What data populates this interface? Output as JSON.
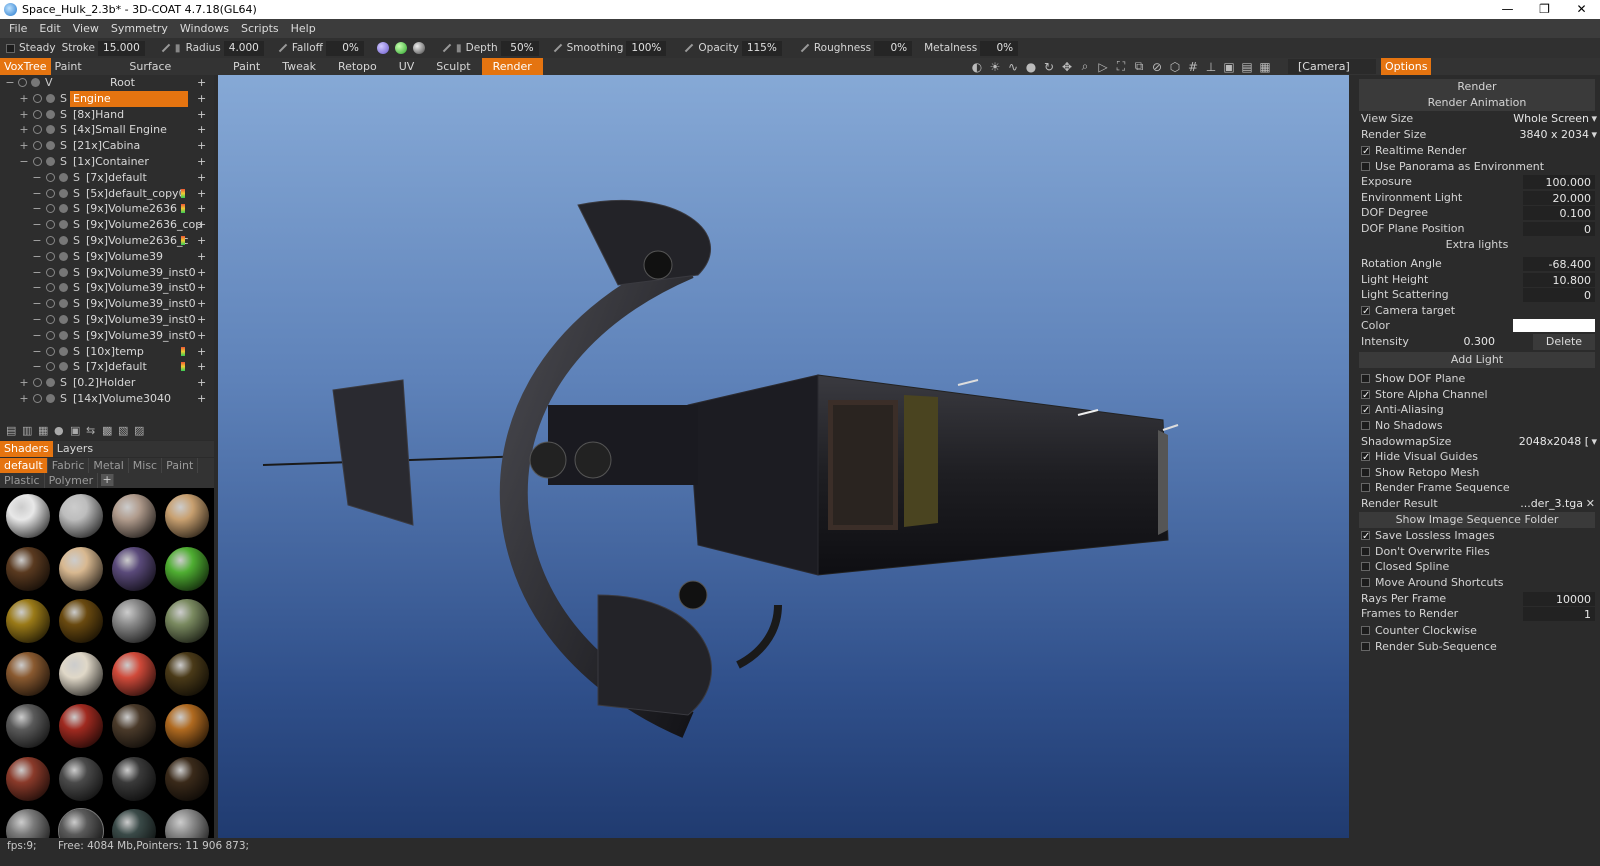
{
  "window": {
    "title": "Space_Hulk_2.3b* - 3D-COAT 4.7.18(GL64)",
    "controls": [
      "—",
      "❐",
      "✕"
    ]
  },
  "menu": [
    "File",
    "Edit",
    "View",
    "Symmetry",
    "Windows",
    "Scripts",
    "Help"
  ],
  "toolbar": {
    "steady_label": "Steady",
    "stroke_label": "Stroke",
    "stroke_value": "15.000",
    "radius_label": "Radius",
    "radius_value": "4.000",
    "falloff_label": "Falloff",
    "falloff_value": "0%",
    "depth_label": "Depth",
    "depth_value": "50%",
    "smoothing_label": "Smoothing",
    "smoothing_value": "100%",
    "opacity_label": "Opacity",
    "opacity_value": "115%",
    "roughness_label": "Roughness",
    "roughness_value": "0%",
    "metalness_label": "Metalness",
    "metalness_value": "0%"
  },
  "left_tabs": [
    "VoxTree",
    "Paint Objects",
    "Surface Materials"
  ],
  "room_tabs": [
    "Paint",
    "Tweak",
    "Retopo",
    "UV",
    "Sculpt",
    "Render"
  ],
  "active_room": "Render",
  "camera_label": "[Camera]",
  "options_tab": "Options",
  "tree": [
    {
      "name": "Root",
      "depth": 0,
      "exp": "−",
      "type": "V",
      "sel": false,
      "mark": false
    },
    {
      "name": "Engine",
      "depth": 1,
      "exp": "+",
      "type": "S",
      "sel": true,
      "mark": false
    },
    {
      "name": "[8x]Hand",
      "depth": 1,
      "exp": "+",
      "type": "S",
      "sel": false,
      "mark": false
    },
    {
      "name": "[4x]Small Engine",
      "depth": 1,
      "exp": "+",
      "type": "S",
      "sel": false,
      "mark": false
    },
    {
      "name": "[21x]Cabina",
      "depth": 1,
      "exp": "+",
      "type": "S",
      "sel": false,
      "mark": false
    },
    {
      "name": "[1x]Container",
      "depth": 1,
      "exp": "−",
      "type": "S",
      "sel": false,
      "mark": false
    },
    {
      "name": "[7x]default",
      "depth": 2,
      "exp": "−",
      "type": "S",
      "sel": false,
      "mark": false
    },
    {
      "name": "[5x]default_copy0",
      "depth": 2,
      "exp": "−",
      "type": "S",
      "sel": false,
      "mark": true
    },
    {
      "name": "[9x]Volume2636",
      "depth": 2,
      "exp": "−",
      "type": "S",
      "sel": false,
      "mark": true
    },
    {
      "name": "[9x]Volume2636_cop",
      "depth": 2,
      "exp": "−",
      "type": "S",
      "sel": false,
      "mark": false
    },
    {
      "name": "[9x]Volume2636_c",
      "depth": 2,
      "exp": "−",
      "type": "S",
      "sel": false,
      "mark": true
    },
    {
      "name": "[9x]Volume39",
      "depth": 2,
      "exp": "−",
      "type": "S",
      "sel": false,
      "mark": false
    },
    {
      "name": "[9x]Volume39_inst0",
      "depth": 2,
      "exp": "−",
      "type": "S",
      "sel": false,
      "mark": false
    },
    {
      "name": "[9x]Volume39_inst0",
      "depth": 2,
      "exp": "−",
      "type": "S",
      "sel": false,
      "mark": false
    },
    {
      "name": "[9x]Volume39_inst0",
      "depth": 2,
      "exp": "−",
      "type": "S",
      "sel": false,
      "mark": false
    },
    {
      "name": "[9x]Volume39_inst0",
      "depth": 2,
      "exp": "−",
      "type": "S",
      "sel": false,
      "mark": false
    },
    {
      "name": "[9x]Volume39_inst0",
      "depth": 2,
      "exp": "−",
      "type": "S",
      "sel": false,
      "mark": false
    },
    {
      "name": "[10x]temp",
      "depth": 2,
      "exp": "−",
      "type": "S",
      "sel": false,
      "mark": true
    },
    {
      "name": "[7x]default",
      "depth": 2,
      "exp": "−",
      "type": "S",
      "sel": false,
      "mark": true
    },
    {
      "name": "[0.2]Holder",
      "depth": 1,
      "exp": "+",
      "type": "S",
      "sel": false,
      "mark": false
    },
    {
      "name": "[14x]Volume3040",
      "depth": 1,
      "exp": "+",
      "type": "S",
      "sel": false,
      "mark": false
    }
  ],
  "tree_icons": [
    "trash-icon",
    "trash-all-icon",
    "copy-icon",
    "sphere-icon",
    "layers-icon",
    "arrows-icon",
    "grid-icon",
    "merge-icon",
    "image-icon"
  ],
  "shader_tabs": [
    "Shaders",
    "Layers"
  ],
  "shader_categories": [
    "default",
    "Fabric",
    "Metal",
    "Misc",
    "Paint",
    "Plastic",
    "Polymer"
  ],
  "shaders": [
    "#e8e8e8",
    "#bdbdbd",
    "#b09b8c",
    "#c8a070",
    "#5a3a20",
    "#d8b890",
    "#5a4a7a",
    "#4fae32",
    "#9a7a18",
    "#6a4a10",
    "#8a8a8a",
    "#7a8a60",
    "#8a5a30",
    "#e0d8c8",
    "#d04a3a",
    "#4a3a18",
    "#5a5a5a",
    "#a02a20",
    "#4a3a2a",
    "#b06a20",
    "#8a3a2a",
    "#4a4a4a",
    "#3a3a3a",
    "#3a2a1a",
    "#7a7a7a",
    "#5a5a5a",
    "#3a4a48",
    "#8a8a8a"
  ],
  "options": {
    "render_btn": "Render",
    "render_anim_btn": "Render Animation",
    "view_size_label": "View Size",
    "view_size_value": "Whole Screen",
    "render_size_label": "Render Size",
    "render_size_value": "3840 x 2034",
    "realtime_render": "Realtime Render",
    "use_panorama": "Use Panorama as Environment",
    "exposure_label": "Exposure",
    "exposure_value": "100.000",
    "env_light_label": "Environment Light",
    "env_light_value": "20.000",
    "dof_degree_label": "DOF Degree",
    "dof_degree_value": "0.100",
    "dof_plane_label": "DOF Plane Position",
    "dof_plane_value": "0",
    "extra_lights": "Extra lights",
    "rotation_label": "Rotation Angle",
    "rotation_value": "-68.400",
    "light_height_label": "Light Height",
    "light_height_value": "10.800",
    "light_scatter_label": "Light Scattering",
    "light_scatter_value": "0",
    "camera_target": "Camera target",
    "color_label": "Color",
    "intensity_label": "Intensity",
    "intensity_value": "0.300",
    "delete_btn": "Delete",
    "add_light_btn": "Add Light",
    "show_dof": "Show DOF Plane",
    "store_alpha": "Store Alpha Channel",
    "anti_alias": "Anti-Aliasing",
    "no_shadows": "No Shadows",
    "shadowmap_label": "ShadowmapSize",
    "shadowmap_value": "2048x2048 [",
    "hide_guides": "Hide Visual Guides",
    "show_retopo": "Show Retopo Mesh",
    "render_frame_seq": "Render Frame Sequence",
    "render_result_label": "Render Result",
    "render_result_value": "...der_3.tga",
    "show_seq_folder_btn": "Show Image Sequence Folder",
    "save_lossless": "Save Lossless Images",
    "dont_overwrite": "Don't Overwrite Files",
    "closed_spline": "Closed Spline",
    "move_around": "Move Around Shortcuts",
    "rays_label": "Rays Per Frame",
    "rays_value": "10000",
    "frames_label": "Frames to Render",
    "frames_value": "1",
    "counter_clockwise": "Counter Clockwise",
    "render_subseq": "Render Sub-Sequence"
  },
  "status": {
    "fps": "fps:9;",
    "mem": "Free: 4084 Mb,Pointers: 11 906 873;"
  }
}
